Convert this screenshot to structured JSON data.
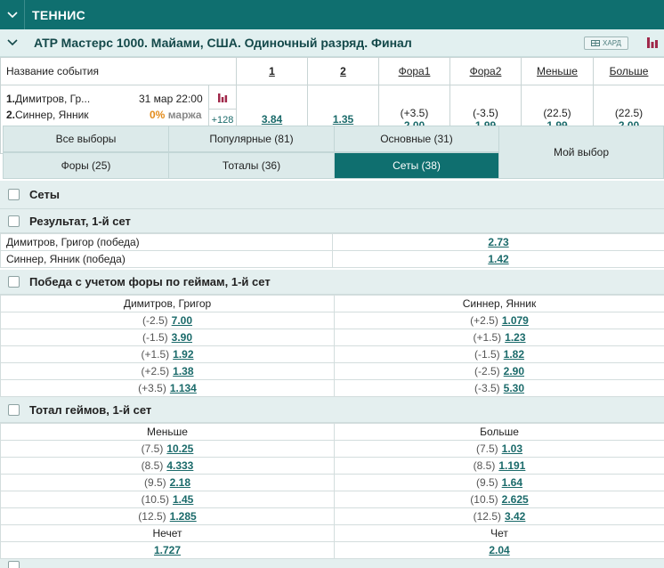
{
  "sport": {
    "title": "ТЕННИС"
  },
  "league": {
    "title": "ATP Мастерс 1000. Майами, США. Одиночный разряд. Финал",
    "surface": "ХАРД"
  },
  "events_header": {
    "name": "Название события",
    "col1": "1",
    "col2": "2",
    "fora1": "Фора1",
    "fora2": "Фора2",
    "less": "Меньше",
    "more": "Больше"
  },
  "event": {
    "team1_num": "1.",
    "team1": "Димитров, Гр...",
    "team2_num": "2.",
    "team2": "Синнер, Янник",
    "datetime": "31 мар 22:00",
    "margin_pct": "0%",
    "margin_label": "маржа",
    "more_count": "+128",
    "odds1": "3.84",
    "odds2": "1.35",
    "fora1_h": "(+3.5)",
    "fora1_c": "2.00",
    "fora2_h": "(-3.5)",
    "fora2_c": "1.99",
    "less_h": "(22.5)",
    "less_c": "1.99",
    "more_h": "(22.5)",
    "more_c": "2.00"
  },
  "tabs": {
    "all": "Все выборы",
    "popular": "Популярные (81)",
    "main": "Основные (31)",
    "fora": "Форы (25)",
    "totals": "Тоталы (36)",
    "sets": "Сеты (38)",
    "my": "Мой выбор"
  },
  "sections": {
    "sets": "Сеты",
    "result": "Результат, 1-й сет",
    "handicap": "Победа с учетом форы по геймам, 1-й сет",
    "total": "Тотал геймов, 1-й сет"
  },
  "result_rows": [
    {
      "label": "Димитров, Григор (победа)",
      "coef": "2.73"
    },
    {
      "label": "Синнер, Янник (победа)",
      "coef": "1.42"
    }
  ],
  "handicap": {
    "left_head": "Димитров, Григор",
    "right_head": "Синнер, Янник",
    "rows": [
      {
        "lh": "(-2.5)",
        "lc": "7.00",
        "rh": "(+2.5)",
        "rc": "1.079"
      },
      {
        "lh": "(-1.5)",
        "lc": "3.90",
        "rh": "(+1.5)",
        "rc": "1.23"
      },
      {
        "lh": "(+1.5)",
        "lc": "1.92",
        "rh": "(-1.5)",
        "rc": "1.82"
      },
      {
        "lh": "(+2.5)",
        "lc": "1.38",
        "rh": "(-2.5)",
        "rc": "2.90"
      },
      {
        "lh": "(+3.5)",
        "lc": "1.134",
        "rh": "(-3.5)",
        "rc": "5.30"
      }
    ]
  },
  "total": {
    "left_head": "Меньше",
    "right_head": "Больше",
    "rows": [
      {
        "lh": "(7.5)",
        "lc": "10.25",
        "rh": "(7.5)",
        "rc": "1.03"
      },
      {
        "lh": "(8.5)",
        "lc": "4.333",
        "rh": "(8.5)",
        "rc": "1.191"
      },
      {
        "lh": "(9.5)",
        "lc": "2.18",
        "rh": "(9.5)",
        "rc": "1.64"
      },
      {
        "lh": "(10.5)",
        "lc": "1.45",
        "rh": "(10.5)",
        "rc": "2.625"
      },
      {
        "lh": "(12.5)",
        "lc": "1.285",
        "rh": "(12.5)",
        "rc": "3.42"
      }
    ],
    "odd_label": "Нечет",
    "even_label": "Чет",
    "odd_coef": "1.727",
    "even_coef": "2.04"
  },
  "colors": {
    "brand": "#0f6f6f",
    "coef": "#1a6a6a",
    "margin": "#e38b1a",
    "stats_icon": "#a0284a"
  }
}
